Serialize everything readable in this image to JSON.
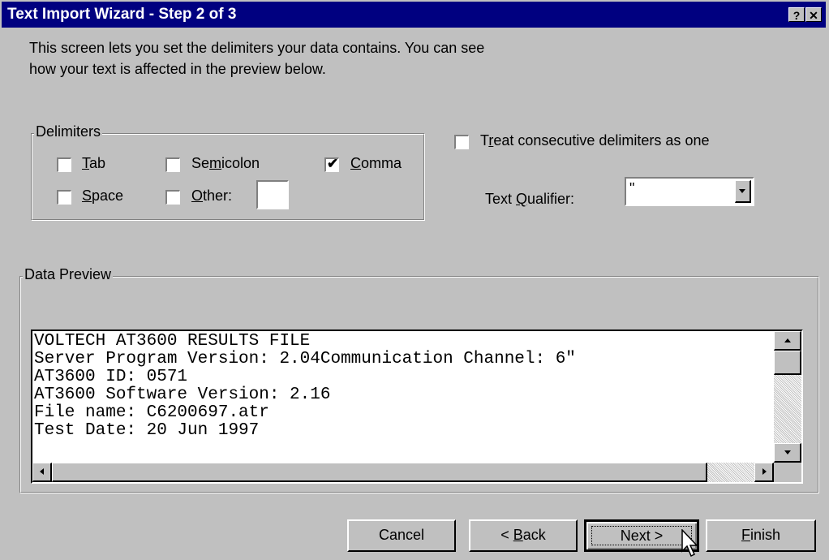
{
  "window": {
    "title": "Text Import Wizard - Step 2 of 3",
    "help_btn": "?",
    "close_btn": "✕"
  },
  "intro": {
    "line1": "This screen lets you set the delimiters your data contains.  You can see",
    "line2": "how your text is affected in the preview below."
  },
  "delimiters": {
    "legend": "Delimiters",
    "tab": {
      "pre": "",
      "key": "T",
      "post": "ab",
      "checked": false
    },
    "semicolon": {
      "pre": "Se",
      "key": "m",
      "post": "icolon",
      "checked": false
    },
    "comma": {
      "pre": "",
      "key": "C",
      "post": "omma",
      "checked": true
    },
    "space": {
      "pre": "",
      "key": "S",
      "post": "pace",
      "checked": false
    },
    "other": {
      "pre": "",
      "key": "O",
      "post": "ther:",
      "checked": false,
      "value": ""
    }
  },
  "consecutive": {
    "pre": "T",
    "key": "r",
    "post": "eat consecutive delimiters as one",
    "checked": false
  },
  "qualifier": {
    "pre": "Text ",
    "key": "Q",
    "post": "ualifier:",
    "value": "\""
  },
  "preview": {
    "legend": "Data Preview",
    "lines": [
      "VOLTECH AT3600 RESULTS FILE",
      "Server Program Version: 2.04Communication Channel: 6\"",
      "AT3600 ID: 0571",
      "AT3600 Software Version: 2.16",
      "File name: C6200697.atr",
      "Test Date: 20 Jun 1997"
    ]
  },
  "buttons": {
    "cancel": "Cancel",
    "back": {
      "pre": "< ",
      "key": "B",
      "post": "ack"
    },
    "next": "Next >",
    "finish": {
      "pre": "",
      "key": "F",
      "post": "inish"
    }
  },
  "icons": {
    "checkmark": "check-icon",
    "scroll_up": "arrow-up-icon",
    "scroll_down": "arrow-down-icon",
    "scroll_left": "arrow-left-icon",
    "scroll_right": "arrow-right-icon",
    "dropdown": "arrow-down-icon",
    "cursor": "mouse-pointer-icon"
  },
  "colors": {
    "titlebar": "#000080",
    "face": "#c0c0c0"
  }
}
